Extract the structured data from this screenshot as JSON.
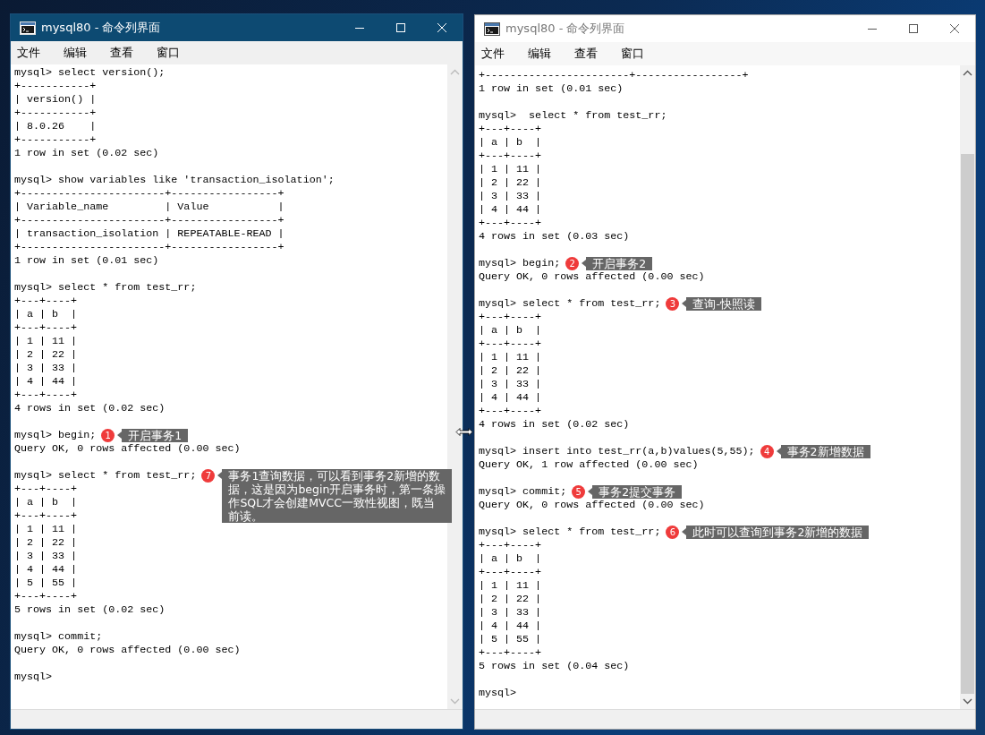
{
  "windows": [
    {
      "title": "mysql80 - 命令列界面",
      "active": true,
      "scrollable": false,
      "menu": [
        "文件",
        "编辑",
        "查看",
        "窗口"
      ],
      "lines": [
        {
          "text": "mysql> select version();"
        },
        {
          "text": "+-----------+"
        },
        {
          "text": "| version() |"
        },
        {
          "text": "+-----------+"
        },
        {
          "text": "| 8.0.26    |"
        },
        {
          "text": "+-----------+"
        },
        {
          "text": "1 row in set (0.02 sec)"
        },
        {
          "text": "mysql> show variables like 'transaction_isolation';",
          "blank_before": true
        },
        {
          "text": "+-----------------------+-----------------+"
        },
        {
          "text": "| Variable_name         | Value           |"
        },
        {
          "text": "+-----------------------+-----------------+"
        },
        {
          "text": "| transaction_isolation | REPEATABLE-READ |"
        },
        {
          "text": "+-----------------------+-----------------+"
        },
        {
          "text": "1 row in set (0.01 sec)"
        },
        {
          "text": "mysql> select * from test_rr;",
          "blank_before": true
        },
        {
          "text": "+---+----+"
        },
        {
          "text": "| a | b  |"
        },
        {
          "text": "+---+----+"
        },
        {
          "text": "| 1 | 11 |"
        },
        {
          "text": "| 2 | 22 |"
        },
        {
          "text": "| 3 | 33 |"
        },
        {
          "text": "| 4 | 44 |"
        },
        {
          "text": "+---+----+"
        },
        {
          "text": "4 rows in set (0.02 sec)"
        },
        {
          "text": "mysql> begin;",
          "blank_before": true,
          "note": {
            "number": "1",
            "text": "开启事务1"
          }
        },
        {
          "text": "Query OK, 0 rows affected (0.00 sec)"
        },
        {
          "text": "mysql> select * from test_rr;",
          "blank_before": true,
          "note": {
            "number": "7",
            "text": "事务1查询数据，可以看到事务2新增的数据，这是因为begin开启事务时，第一条操作SQL才会创建MVCC一致性视图，既当前读。"
          }
        },
        {
          "text": "+---+----+"
        },
        {
          "text": "| a | b  |"
        },
        {
          "text": "+---+----+"
        },
        {
          "text": "| 1 | 11 |"
        },
        {
          "text": "| 2 | 22 |"
        },
        {
          "text": "| 3 | 33 |"
        },
        {
          "text": "| 4 | 44 |"
        },
        {
          "text": "| 5 | 55 |"
        },
        {
          "text": "+---+----+"
        },
        {
          "text": "5 rows in set (0.02 sec)"
        },
        {
          "text": "mysql> commit;",
          "blank_before": true
        },
        {
          "text": "Query OK, 0 rows affected (0.00 sec)"
        },
        {
          "text": "mysql>",
          "blank_before": true
        }
      ]
    },
    {
      "title": "mysql80 - 命令列界面",
      "active": false,
      "scrollable": true,
      "menu": [
        "文件",
        "编辑",
        "查看",
        "窗口"
      ],
      "lines": [
        {
          "text": "+-----------------------+-----------------+"
        },
        {
          "text": "1 row in set (0.01 sec)"
        },
        {
          "text": "mysql>  select * from test_rr;",
          "blank_before": true
        },
        {
          "text": "+---+----+"
        },
        {
          "text": "| a | b  |"
        },
        {
          "text": "+---+----+"
        },
        {
          "text": "| 1 | 11 |"
        },
        {
          "text": "| 2 | 22 |"
        },
        {
          "text": "| 3 | 33 |"
        },
        {
          "text": "| 4 | 44 |"
        },
        {
          "text": "+---+----+"
        },
        {
          "text": "4 rows in set (0.03 sec)"
        },
        {
          "text": "mysql> begin;",
          "blank_before": true,
          "note": {
            "number": "2",
            "text": "开启事务2"
          }
        },
        {
          "text": "Query OK, 0 rows affected (0.00 sec)"
        },
        {
          "text": "mysql> select * from test_rr;",
          "blank_before": true,
          "note": {
            "number": "3",
            "text": "查询-快照读"
          }
        },
        {
          "text": "+---+----+"
        },
        {
          "text": "| a | b  |"
        },
        {
          "text": "+---+----+"
        },
        {
          "text": "| 1 | 11 |"
        },
        {
          "text": "| 2 | 22 |"
        },
        {
          "text": "| 3 | 33 |"
        },
        {
          "text": "| 4 | 44 |"
        },
        {
          "text": "+---+----+"
        },
        {
          "text": "4 rows in set (0.02 sec)"
        },
        {
          "text": "mysql> insert into test_rr(a,b)values(5,55);",
          "blank_before": true,
          "note": {
            "number": "4",
            "text": "事务2新增数据"
          }
        },
        {
          "text": "Query OK, 1 row affected (0.00 sec)"
        },
        {
          "text": "mysql> commit;",
          "blank_before": true,
          "note": {
            "number": "5",
            "text": "事务2提交事务"
          }
        },
        {
          "text": "Query OK, 0 rows affected (0.00 sec)"
        },
        {
          "text": "mysql> select * from test_rr;",
          "blank_before": true,
          "note": {
            "number": "6",
            "text": "此时可以查询到事务2新增的数据"
          }
        },
        {
          "text": "+---+----+"
        },
        {
          "text": "| a | b  |"
        },
        {
          "text": "+---+----+"
        },
        {
          "text": "| 1 | 11 |"
        },
        {
          "text": "| 2 | 22 |"
        },
        {
          "text": "| 3 | 33 |"
        },
        {
          "text": "| 4 | 44 |"
        },
        {
          "text": "| 5 | 55 |"
        },
        {
          "text": "+---+----+"
        },
        {
          "text": "5 rows in set (0.04 sec)"
        },
        {
          "text": "mysql>",
          "blank_before": true
        }
      ]
    }
  ]
}
